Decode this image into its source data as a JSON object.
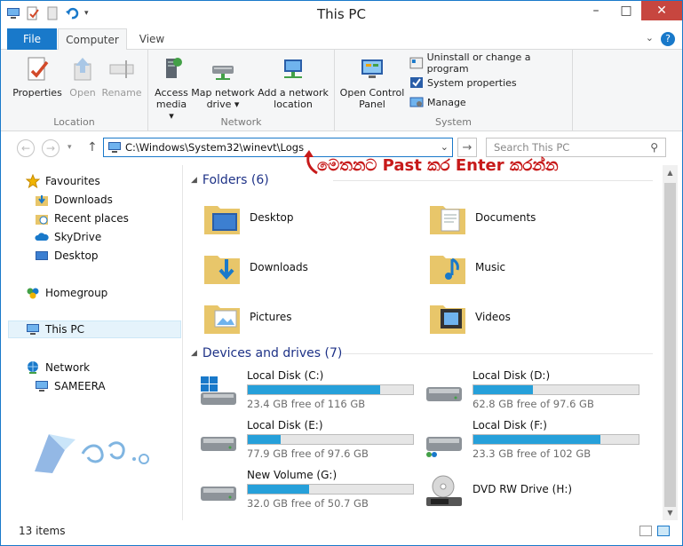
{
  "window": {
    "title": "This PC"
  },
  "tabs": {
    "file": "File",
    "computer": "Computer",
    "view": "View"
  },
  "ribbon": {
    "location": {
      "label": "Location",
      "properties": "Properties",
      "open": "Open",
      "rename": "Rename"
    },
    "network": {
      "label": "Network",
      "access_media": [
        "Access",
        "media ▾"
      ],
      "map_drive": [
        "Map network",
        "drive ▾"
      ],
      "add_location": [
        "Add a network",
        "location"
      ]
    },
    "system": {
      "label": "System",
      "control_panel": [
        "Open Control",
        "Panel"
      ],
      "uninstall": "Uninstall or change a program",
      "properties": "System properties",
      "manage": "Manage"
    }
  },
  "address": {
    "path": "C:\\Windows\\System32\\winevt\\Logs"
  },
  "search": {
    "placeholder": "Search This PC"
  },
  "annotation": {
    "text": "මෙතනට Past කර Enter කරන්න"
  },
  "nav": {
    "favourites": "Favourites",
    "downloads": "Downloads",
    "recent": "Recent places",
    "skydrive": "SkyDrive",
    "desktop": "Desktop",
    "homegroup": "Homegroup",
    "thispc": "This PC",
    "network": "Network",
    "sameera": "SAMEERA"
  },
  "folders": {
    "header": "Folders (6)",
    "items": [
      "Desktop",
      "Documents",
      "Downloads",
      "Music",
      "Pictures",
      "Videos"
    ]
  },
  "drives": {
    "header": "Devices and drives (7)",
    "items": [
      {
        "name": "Local Disk (C:)",
        "free": "23.4 GB free of 116 GB",
        "used": 0.8
      },
      {
        "name": "Local Disk (D:)",
        "free": "62.8 GB free of 97.6 GB",
        "used": 0.36
      },
      {
        "name": "Local Disk (E:)",
        "free": "77.9 GB free of 97.6 GB",
        "used": 0.2
      },
      {
        "name": "Local Disk (F:)",
        "free": "23.3 GB free of 102 GB",
        "used": 0.77
      },
      {
        "name": "New Volume (G:)",
        "free": "32.0 GB free of 50.7 GB",
        "used": 0.37
      },
      {
        "name": "DVD RW Drive (H:)"
      }
    ]
  },
  "status": {
    "count": "13 items"
  },
  "colors": {
    "accent": "#1979ca",
    "bar": "#26a0da",
    "annotation": "#c71a1a"
  }
}
